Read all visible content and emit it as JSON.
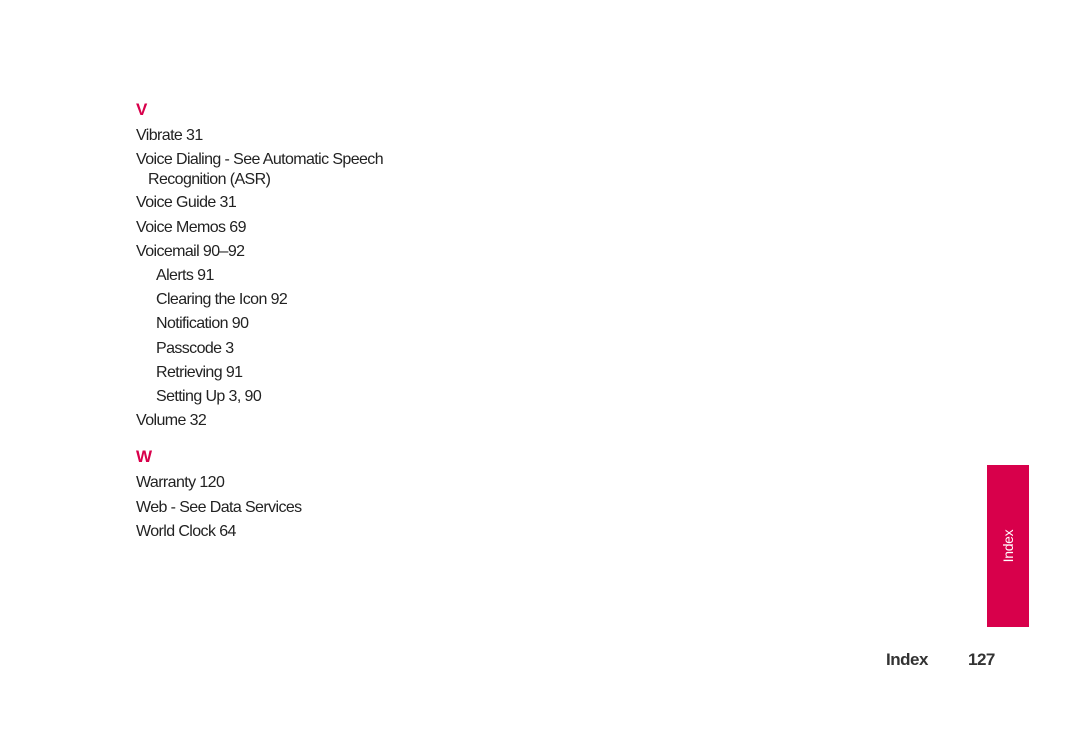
{
  "sections": [
    {
      "letter": "V",
      "entries": [
        {
          "text": "Vibrate  31",
          "level": 0
        },
        {
          "text": "Voice Dialing - See Automatic Speech",
          "level": 0
        },
        {
          "text": "Recognition (ASR)",
          "level": "cont"
        },
        {
          "text": "Voice Guide  31",
          "level": 0
        },
        {
          "text": "Voice Memos  69",
          "level": 0
        },
        {
          "text": "Voicemail  90–92",
          "level": 0
        },
        {
          "text": "Alerts  91",
          "level": 1
        },
        {
          "text": "Clearing the Icon  92",
          "level": 1
        },
        {
          "text": "Notification  90",
          "level": 1
        },
        {
          "text": "Passcode  3",
          "level": 1
        },
        {
          "text": "Retrieving  91",
          "level": 1
        },
        {
          "text": "Setting Up  3, 90",
          "level": 1
        },
        {
          "text": "Volume  32",
          "level": 0
        }
      ]
    },
    {
      "letter": "W",
      "entries": [
        {
          "text": "Warranty  120",
          "level": 0
        },
        {
          "text": "Web - See Data Services",
          "level": 0
        },
        {
          "text": "World Clock  64",
          "level": 0
        }
      ]
    }
  ],
  "side_tab": {
    "label": "Index",
    "color": "#d8004b"
  },
  "footer": {
    "section_title": "Index",
    "page_number": "127"
  },
  "accent_color": "#d8004b"
}
